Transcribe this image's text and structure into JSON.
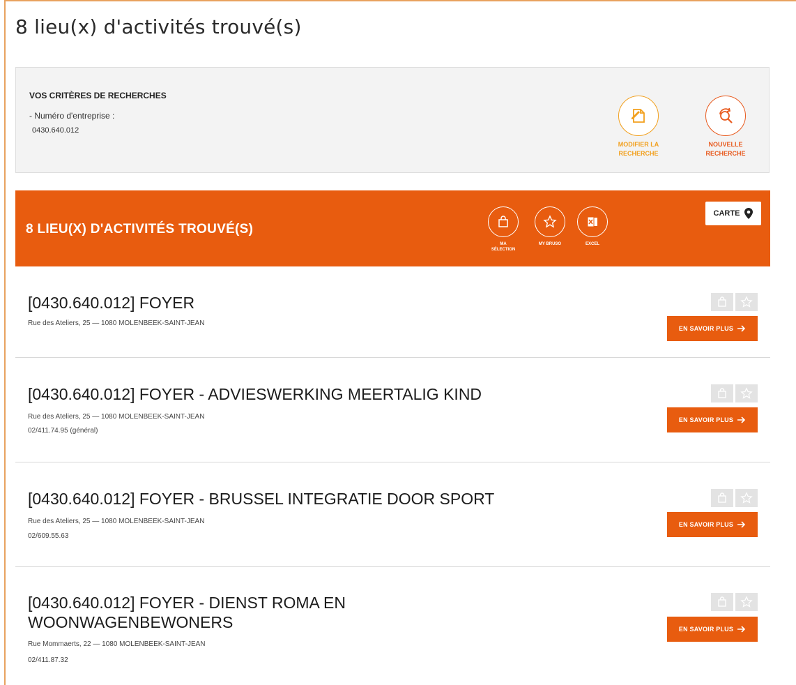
{
  "page_title": "8 lieu(x) d'activités trouvé(s)",
  "criteria": {
    "heading": "VOS CRITÈRES DE RECHERCHES",
    "label": "- Numéro d'entreprise :",
    "value": "0430.640.012",
    "modify_label": "MODIFIER LA\nRECHERCHE",
    "new_label": "NOUVELLE\nRECHERCHE"
  },
  "results_bar": {
    "title": "8 LIEU(X) D'ACTIVITÉS TROUVÉ(S)",
    "selection_label": "MA\nSÉLECTION",
    "mybruso_label": "MY BRUSO",
    "excel_label": "EXCEL",
    "carte_label": "CARTE"
  },
  "more_label": "EN SAVOIR PLUS",
  "results": [
    {
      "title": "[0430.640.012] FOYER",
      "address": "Rue des Ateliers, 25 — 1080 MOLENBEEK-SAINT-JEAN",
      "phone": ""
    },
    {
      "title": "[0430.640.012] FOYER - ADVIESWERKING MEERTALIG KIND",
      "address": "Rue des Ateliers, 25 — 1080 MOLENBEEK-SAINT-JEAN",
      "phone": "02/411.74.95 (général)"
    },
    {
      "title": "[0430.640.012] FOYER - BRUSSEL INTEGRATIE DOOR SPORT",
      "address": "Rue des Ateliers, 25 — 1080 MOLENBEEK-SAINT-JEAN",
      "phone": "02/609.55.63"
    },
    {
      "title": "[0430.640.012] FOYER - DIENST ROMA EN WOONWAGENBEWONERS",
      "address": "Rue Mommaerts, 22 — 1080 MOLENBEEK-SAINT-JEAN",
      "phone": "02/411.87.32"
    }
  ],
  "colors": {
    "accent": "#e85c0f",
    "modify": "#f2a01e",
    "new_search": "#e85a1e",
    "tool_bg": "#e3e3e3"
  },
  "icons": {
    "modify": "edit-document-icon",
    "new_search": "refresh-search-icon",
    "selection": "shopping-bag-icon",
    "mybruso": "star-icon",
    "excel": "excel-icon",
    "carte": "map-pin-icon",
    "more": "arrow-right-icon"
  }
}
